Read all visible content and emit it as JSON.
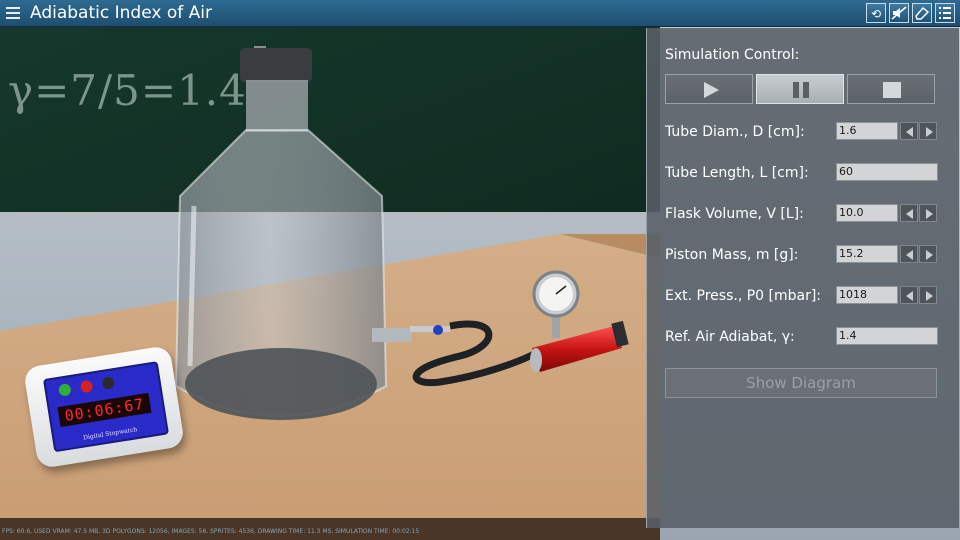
{
  "window": {
    "title": "Adiabatic Index of Air"
  },
  "toolbar_icons": [
    "menu-icon",
    "reset-icon",
    "mute-icon",
    "eraser-icon",
    "settings-list-icon"
  ],
  "blackboard": {
    "formula": "γ=7/5=1.4"
  },
  "stopwatch": {
    "time": "00:06:67",
    "caption": "Digital Stopwatch"
  },
  "panel": {
    "title": "Simulation Control:",
    "controls": [
      "play-icon",
      "pause-icon",
      "stop-icon"
    ],
    "fields": [
      {
        "label": "Tube Diam., D [cm]:",
        "value": "1.6",
        "spinner": true
      },
      {
        "label": "Tube Length, L [cm]:",
        "value": "60",
        "spinner": false
      },
      {
        "label": "Flask Volume, V [L]:",
        "value": "10.0",
        "spinner": true
      },
      {
        "label": "Piston Mass, m [g]:",
        "value": "15.2",
        "spinner": true
      },
      {
        "label": "Ext. Press., P0 [mbar]:",
        "value": "1018",
        "spinner": true
      },
      {
        "label": "Ref. Air Adiabat, γ:",
        "value": "1.4",
        "spinner": false
      }
    ],
    "diagram_button": "Show Diagram"
  },
  "colors": {
    "titlebar": "#1e4e70",
    "panel": "#585e66",
    "led": "#ff2a2a",
    "stopwatch_panel": "#2a2ac8"
  },
  "footer": {
    "stats": "FPS: 60.6, USED VRAM: 47.5 MB, 3D POLYGONS: 12056, IMAGES: 56, SPRITES: 4536, DRAWING TIME: 11.3 MS, SIMULATION TIME: 00:02:15"
  }
}
